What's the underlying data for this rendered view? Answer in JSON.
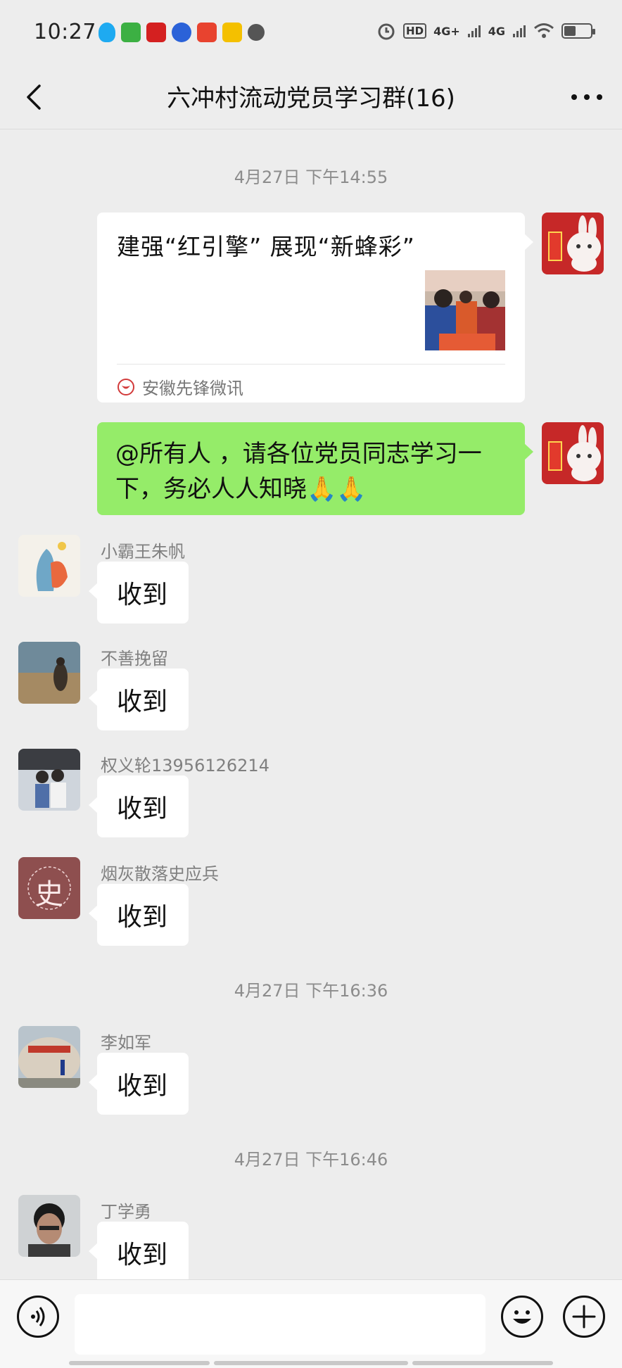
{
  "status_bar": {
    "time": "10:27",
    "network": "4G+",
    "network2": "4G",
    "hd": "HD",
    "battery_level": 0.45
  },
  "nav": {
    "title": "六冲村流动党员学习群(16)",
    "back_icon": "chevron-left-icon",
    "more_icon": "more-dots-icon"
  },
  "chat": {
    "timestamps": [
      "4月27日 下午14:55",
      "4月27日 下午16:36",
      "4月27日 下午16:46"
    ],
    "card": {
      "title": "建强“红引擎” 展现“新蜂彩”",
      "source": "安徽先锋微讯"
    },
    "broadcast": "@所有人 ，请各位党员同志学习一下，务必人人知晓🙏🙏",
    "messages": [
      {
        "sender": "小霸王朱帆",
        "text": "收到"
      },
      {
        "sender": "不善挽留",
        "text": "收到"
      },
      {
        "sender": "权义轮13956126214",
        "text": "收到"
      },
      {
        "sender": "烟灰散落史应兵",
        "text": "收到"
      },
      {
        "sender": "李如军",
        "text": "收到"
      },
      {
        "sender": "丁学勇",
        "text": "收到"
      }
    ],
    "avatar_letter": "史",
    "self_avatar_badge": "兔年大吉"
  },
  "input_bar": {
    "voice_icon": "voice-icon",
    "emoji_icon": "emoji-icon",
    "plus_icon": "plus-icon"
  },
  "colors": {
    "background": "#ededed",
    "bubble_green": "#95ec69",
    "bubble_white": "#ffffff"
  }
}
